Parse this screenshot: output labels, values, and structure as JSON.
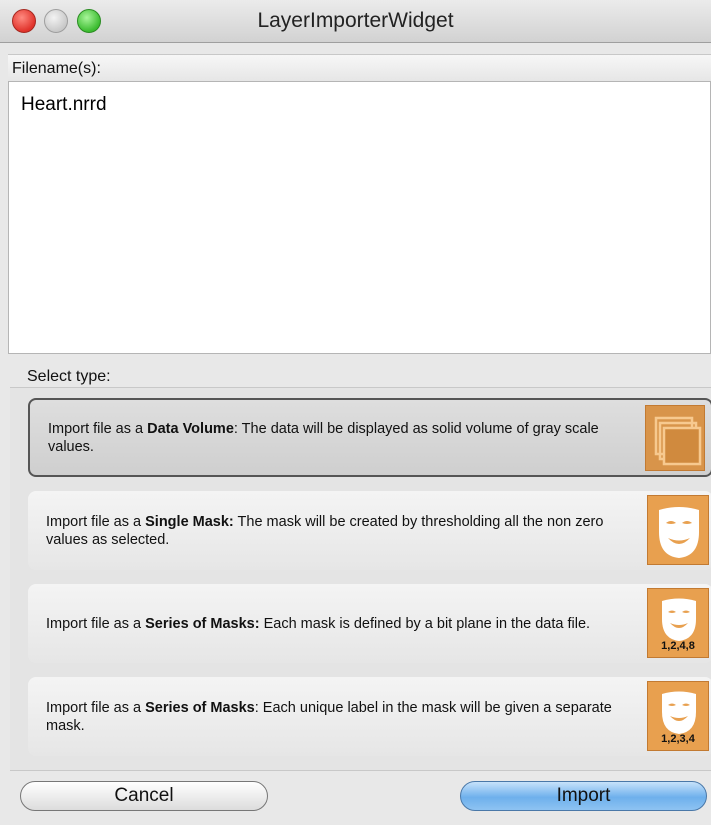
{
  "window": {
    "title": "LayerImporterWidget"
  },
  "filenames": {
    "header": "Filename(s):",
    "items": [
      "Heart.nrrd"
    ]
  },
  "select_type": {
    "label": "Select type:",
    "options": [
      {
        "prefix": "Import file as a ",
        "bold": "Data Volume",
        "rest": ": The data will be displayed as solid volume of gray scale values.",
        "icon": "data-volume-icon",
        "icon_label": "",
        "selected": true
      },
      {
        "prefix": "Import file as a ",
        "bold": "Single Mask:",
        "rest": " The mask will be created by thresholding all the non zero values as selected.",
        "icon": "mask-icon",
        "icon_label": "",
        "selected": false
      },
      {
        "prefix": "Import file as a ",
        "bold": "Series of Masks:",
        "rest": " Each mask is defined by a bit plane in the data file.",
        "icon": "bitplane-masks-icon",
        "icon_label": "1,2,4,8",
        "selected": false
      },
      {
        "prefix": "Import file as a ",
        "bold": "Series of Masks",
        "rest": ": Each unique label in the mask will be given a separate mask.",
        "icon": "label-masks-icon",
        "icon_label": "1,2,3,4",
        "selected": false
      }
    ]
  },
  "buttons": {
    "cancel": "Cancel",
    "import": "Import"
  },
  "colors": {
    "icon_orange": "#e8a04f",
    "import_blue": "#6eb0ec"
  }
}
